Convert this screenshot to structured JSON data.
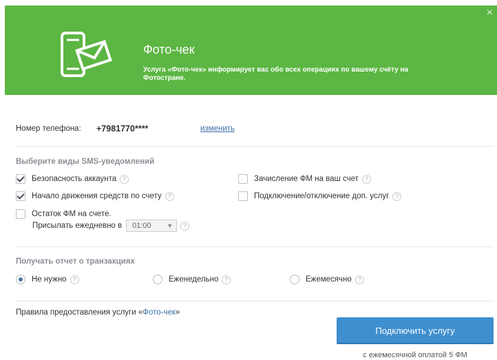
{
  "header": {
    "close": "×",
    "title": "Фото-чек",
    "description": "Услуга «Фото-чек» информирует вас обо всех операциях по вашему счёту на Фотостране."
  },
  "phone": {
    "label": "Номер телефона:",
    "number": "+7981770****",
    "change": "изменить"
  },
  "sms": {
    "title": "Выберите виды SMS-уведомлений",
    "options": [
      {
        "label": "Безопасность аккаунта",
        "checked": true
      },
      {
        "label": "Зачисление ФМ на ваш счет",
        "checked": false
      },
      {
        "label": "Начало движения средств по счету",
        "checked": true
      },
      {
        "label": "Подключение/отключение доп. услуг",
        "checked": false
      },
      {
        "label": "Остаток ФМ на счете.",
        "checked": false
      }
    ],
    "daily_label": "Присылать ежедневно в",
    "daily_time": "01:00",
    "help": "?"
  },
  "report": {
    "title": "Получать отчет о транзакциях",
    "options": [
      {
        "label": "Не нужно",
        "selected": true
      },
      {
        "label": "Еженедельно",
        "selected": false
      },
      {
        "label": "Ежемесячно",
        "selected": false
      }
    ]
  },
  "rules": {
    "prefix": "Правила предоставления услуги «",
    "link": "Фото-чек",
    "suffix": "»"
  },
  "connect_button": "Подключить услугу",
  "fee": "с ежемесячной оплатой 5 ФМ",
  "colors": {
    "header": "#5cb643",
    "button": "#3f8fcf",
    "link": "#3b6ea5"
  }
}
